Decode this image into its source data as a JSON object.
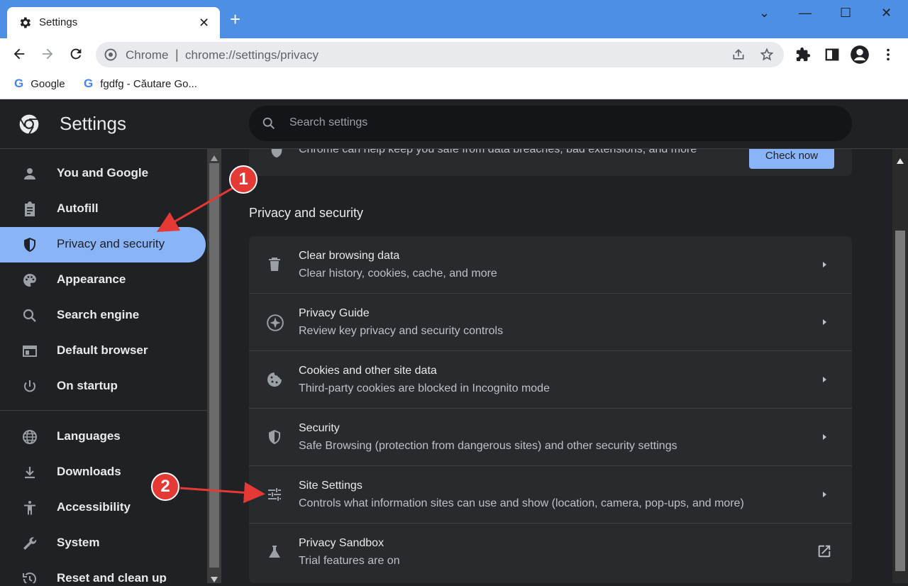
{
  "browser": {
    "tab_title": "Settings",
    "tab_close": "✕",
    "new_tab": "+",
    "window_controls": [
      "⌄",
      "—",
      "☐",
      "✕"
    ],
    "omnibox_chip": "Chrome",
    "omnibox_sep": "|",
    "url": "chrome://settings/privacy",
    "bookmarks": [
      {
        "label": "Google"
      },
      {
        "label": "fgdfg - Căutare Go..."
      }
    ]
  },
  "header": {
    "title": "Settings",
    "search_placeholder": "Search settings"
  },
  "sidebar": {
    "items": [
      {
        "label": "You and Google",
        "icon": "person-icon"
      },
      {
        "label": "Autofill",
        "icon": "clipboard-icon"
      },
      {
        "label": "Privacy and security",
        "icon": "shield-icon",
        "active": true
      },
      {
        "label": "Appearance",
        "icon": "palette-icon"
      },
      {
        "label": "Search engine",
        "icon": "search-icon"
      },
      {
        "label": "Default browser",
        "icon": "browser-window-icon"
      },
      {
        "label": "On startup",
        "icon": "power-icon"
      },
      {
        "label": "Languages",
        "icon": "globe-icon"
      },
      {
        "label": "Downloads",
        "icon": "download-icon"
      },
      {
        "label": "Accessibility",
        "icon": "accessibility-icon"
      },
      {
        "label": "System",
        "icon": "wrench-icon"
      },
      {
        "label": "Reset and clean up",
        "icon": "restore-icon"
      }
    ]
  },
  "main": {
    "safety_check": {
      "text": "Chrome can help keep you safe from data breaches, bad extensions, and more",
      "button": "Check now"
    },
    "section_title": "Privacy and security",
    "rows": [
      {
        "title": "Clear browsing data",
        "subtitle": "Clear history, cookies, cache, and more",
        "icon": "trash-icon"
      },
      {
        "title": "Privacy Guide",
        "subtitle": "Review key privacy and security controls",
        "icon": "compass-icon"
      },
      {
        "title": "Cookies and other site data",
        "subtitle": "Third-party cookies are blocked in Incognito mode",
        "icon": "cookie-icon"
      },
      {
        "title": "Security",
        "subtitle": "Safe Browsing (protection from dangerous sites) and other security settings",
        "icon": "shield-icon"
      },
      {
        "title": "Site Settings",
        "subtitle": "Controls what information sites can use and show (location, camera, pop-ups, and more)",
        "icon": "tune-icon"
      },
      {
        "title": "Privacy Sandbox",
        "subtitle": "Trial features are on",
        "icon": "flask-icon"
      }
    ]
  },
  "annotations": {
    "badge_1": "1",
    "badge_2": "2",
    "color": "#e53935"
  }
}
